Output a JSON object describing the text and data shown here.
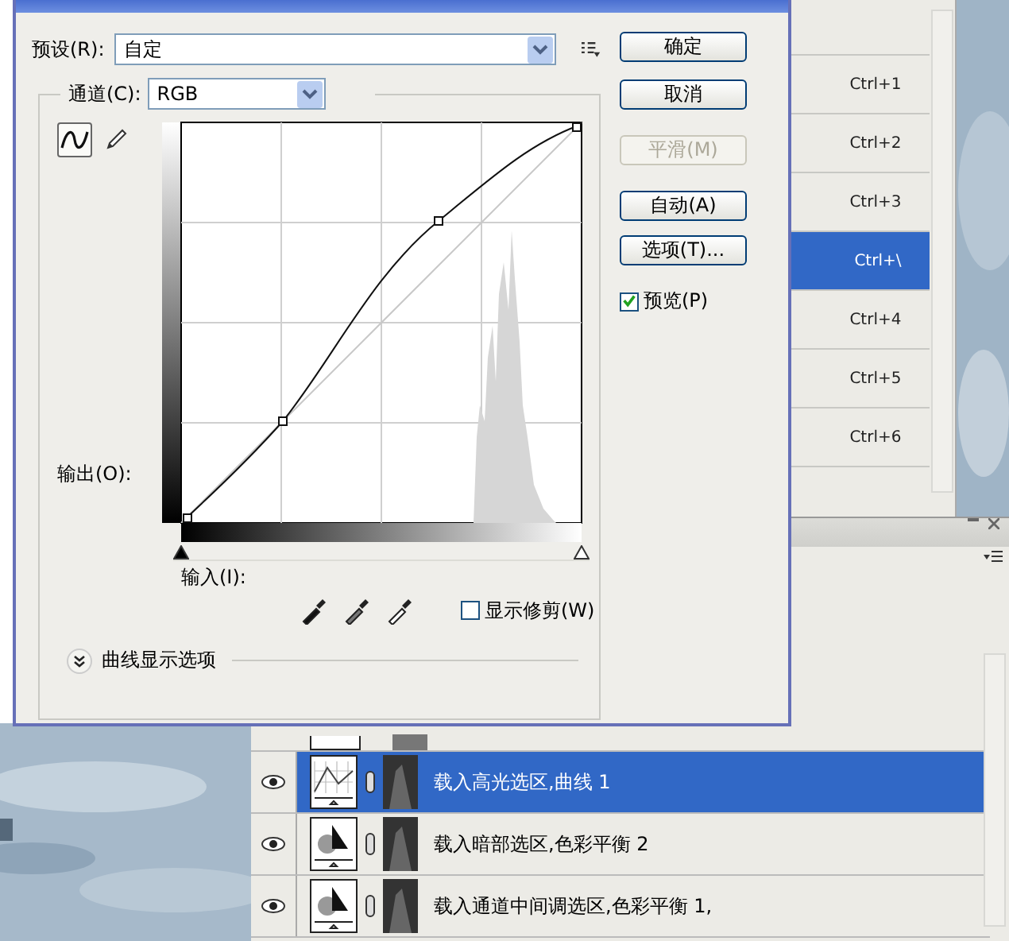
{
  "dialog": {
    "preset_label": "预设(R):",
    "preset": "自定",
    "channel_label": "通道(C):",
    "channel": "RGB",
    "tools": [
      {
        "kind": "curve",
        "selected": true
      },
      {
        "kind": "pencil",
        "selected": false
      }
    ],
    "output_label": "输出(O):",
    "input_label": "输入(I):",
    "show_clipping": {
      "label": "显示修剪(W)",
      "checked": false
    },
    "display_options": "曲线显示选项",
    "input_sliders": [
      {
        "level": 0
      },
      {
        "level": 1
      }
    ],
    "buttons": [
      {
        "label": "确定",
        "disabled": false
      },
      {
        "label": "取消",
        "disabled": false
      },
      {
        "label": "平滑(M)",
        "disabled": true
      },
      {
        "label": "自动(A)",
        "disabled": false
      },
      {
        "label": "选项(T)...",
        "disabled": false
      }
    ],
    "preview": {
      "label": "预览(P)",
      "checked": true
    }
  },
  "channels_panel": {
    "rows": [
      {
        "shortcut": "Ctrl+1",
        "selected": false
      },
      {
        "shortcut": "Ctrl+2",
        "selected": false
      },
      {
        "shortcut": "Ctrl+3",
        "selected": false
      },
      {
        "shortcut": "Ctrl+\\",
        "selected": true
      },
      {
        "shortcut": "Ctrl+4",
        "selected": false
      },
      {
        "shortcut": "Ctrl+5",
        "selected": false
      },
      {
        "shortcut": "Ctrl+6",
        "selected": false
      }
    ]
  },
  "layers_panel": {
    "layers": [
      {
        "name": "载入高光选区,曲线 1",
        "kind": "curves",
        "selected": true
      },
      {
        "name": "载入暗部选区,色彩平衡 2",
        "kind": "color_balance",
        "selected": false
      },
      {
        "name": "载入通道中间调选区,色彩平衡 1,",
        "kind": "color_balance",
        "selected": false
      }
    ]
  }
}
